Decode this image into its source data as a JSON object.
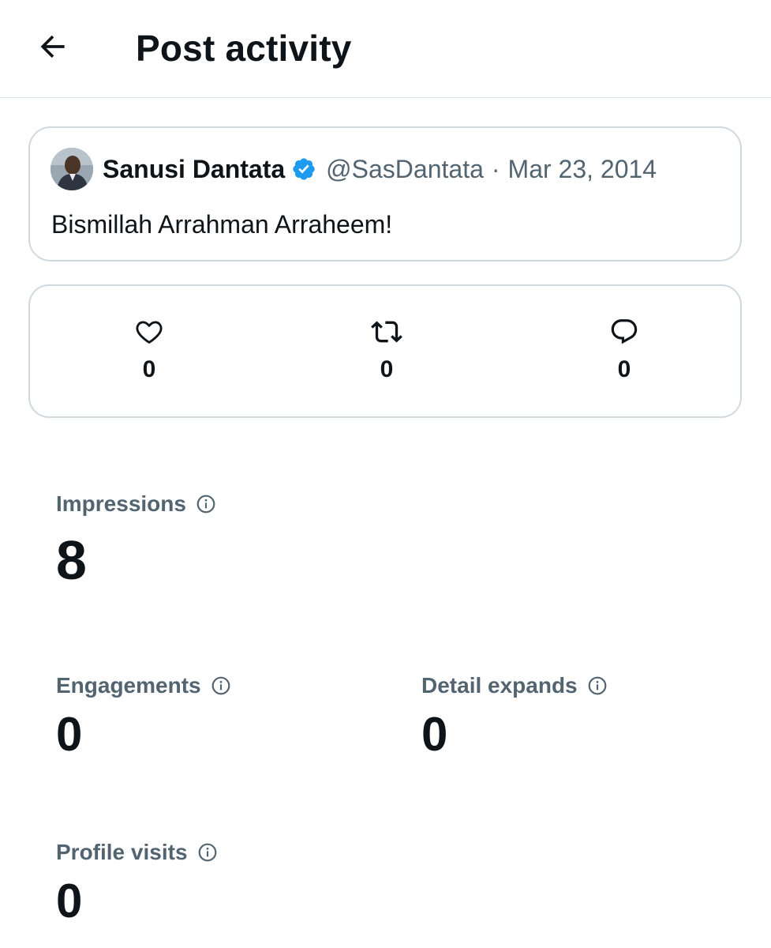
{
  "header": {
    "back_icon": "arrow-left-icon",
    "title": "Post activity"
  },
  "post": {
    "author_name": "Sanusi Dantata",
    "verified_icon": "verified-badge-icon",
    "handle": "@SasDantata",
    "separator": "·",
    "date": "Mar 23, 2014",
    "text": "Bismillah Arrahman Arraheem!",
    "avatar_icon": "avatar-photo"
  },
  "engagement": {
    "likes": {
      "icon": "heart-icon",
      "count": "0"
    },
    "reposts": {
      "icon": "repost-icon",
      "count": "0"
    },
    "replies": {
      "icon": "reply-icon",
      "count": "0"
    }
  },
  "metrics": {
    "impressions": {
      "label": "Impressions",
      "value": "8"
    },
    "engagements": {
      "label": "Engagements",
      "value": "0"
    },
    "detail_expands": {
      "label": "Detail expands",
      "value": "0"
    },
    "profile_visits": {
      "label": "Profile visits",
      "value": "0"
    }
  },
  "colors": {
    "text_primary": "#0f1419",
    "text_secondary": "#536471",
    "border": "#cfd9de",
    "verified_blue": "#1d9bf0"
  }
}
